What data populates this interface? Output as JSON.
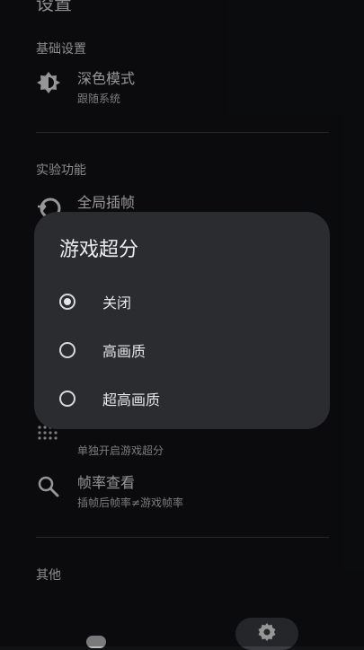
{
  "header": {
    "title": "设置"
  },
  "sections": {
    "basic": "基础设置",
    "experimental": "实验功能",
    "other": "其他"
  },
  "rows": {
    "dark_mode": {
      "title": "深色模式",
      "subtitle": "跟随系统"
    },
    "frame_interp": {
      "title": "全局插帧"
    },
    "game_sr": {
      "subtitle": "单独开启游戏超分"
    },
    "fps_view": {
      "title": "帧率查看",
      "subtitle": "插帧后帧率≠游戏帧率"
    }
  },
  "dialog": {
    "title": "游戏超分",
    "options": [
      {
        "label": "关闭",
        "selected": true
      },
      {
        "label": "高画质",
        "selected": false
      },
      {
        "label": "超高画质",
        "selected": false
      }
    ]
  },
  "icons": {
    "dark_mode": "brightness-icon",
    "frame_interp": "frame-interp-icon",
    "game_sr": "dots-grid-icon",
    "fps_view": "search-icon",
    "nav_games": "gamepad-icon",
    "nav_settings": "gear-icon"
  }
}
